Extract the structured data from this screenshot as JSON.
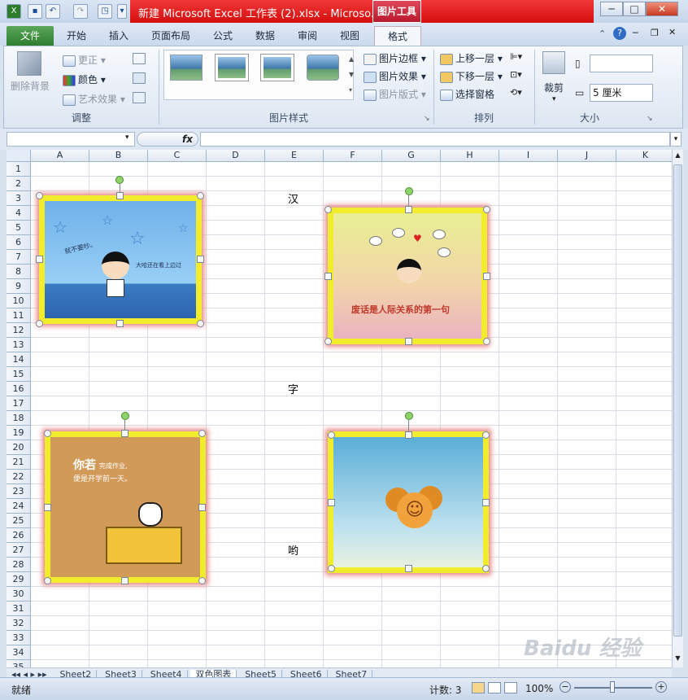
{
  "window": {
    "title": "新建 Microsoft Excel 工作表 (2).xlsx - Microso...",
    "contextual_tab_group": "图片工具",
    "controls": {
      "minimize": "─",
      "maximize": "□",
      "close": "✕"
    }
  },
  "tabs": [
    {
      "label": "文件"
    },
    {
      "label": "开始"
    },
    {
      "label": "插入"
    },
    {
      "label": "页面布局"
    },
    {
      "label": "公式"
    },
    {
      "label": "数据"
    },
    {
      "label": "审阅"
    },
    {
      "label": "视图"
    },
    {
      "label": "格式"
    }
  ],
  "ribbon": {
    "adjust": {
      "remove_bg": "删除背景",
      "corrections": "更正",
      "color": "颜色",
      "artistic": "艺术效果",
      "label": "调整"
    },
    "styles": {
      "border": "图片边框",
      "effects": "图片效果",
      "layout": "图片版式",
      "label": "图片样式"
    },
    "arrange": {
      "bring_forward": "上移一层",
      "send_backward": "下移一层",
      "selection_pane": "选择窗格",
      "label": "排列"
    },
    "size": {
      "crop": "裁剪",
      "height_value": "",
      "width_value": "5 厘米",
      "label": "大小"
    }
  },
  "formula_bar": {
    "fx": "fx",
    "name_box": "",
    "content": ""
  },
  "columns": [
    "A",
    "B",
    "C",
    "D",
    "E",
    "F",
    "G",
    "H",
    "I",
    "J",
    "K"
  ],
  "rows": [
    "1",
    "2",
    "3",
    "4",
    "5",
    "6",
    "7",
    "8",
    "9",
    "10",
    "11",
    "12",
    "13",
    "14",
    "15",
    "16",
    "17",
    "18",
    "19",
    "20",
    "21",
    "22",
    "23",
    "24",
    "25",
    "26",
    "27",
    "28",
    "29",
    "30",
    "31",
    "32",
    "33",
    "34",
    "35"
  ],
  "cells": {
    "E3": "汉",
    "E16": "字",
    "E27": "哟"
  },
  "pictures": [
    {
      "name": "picture-boy-stars",
      "caption_1": "就不要吵。",
      "caption_2": "大哈还在看上边过"
    },
    {
      "name": "picture-boy-speech",
      "caption": "废话是人际关系的第一句"
    },
    {
      "name": "picture-cat-desk",
      "caption_1": "你若",
      "caption_2": "完成作业,",
      "caption_3": "便是开学前一天。"
    },
    {
      "name": "picture-smiley-balls"
    }
  ],
  "sheets": [
    "Sheet2",
    "Sheet3",
    "Sheet4",
    "双色图表",
    "Sheet5",
    "Sheet6",
    "Sheet7"
  ],
  "status": {
    "ready": "就绪",
    "count": "计数: 3",
    "zoom": "100%"
  },
  "watermark": "Baidu 经验"
}
